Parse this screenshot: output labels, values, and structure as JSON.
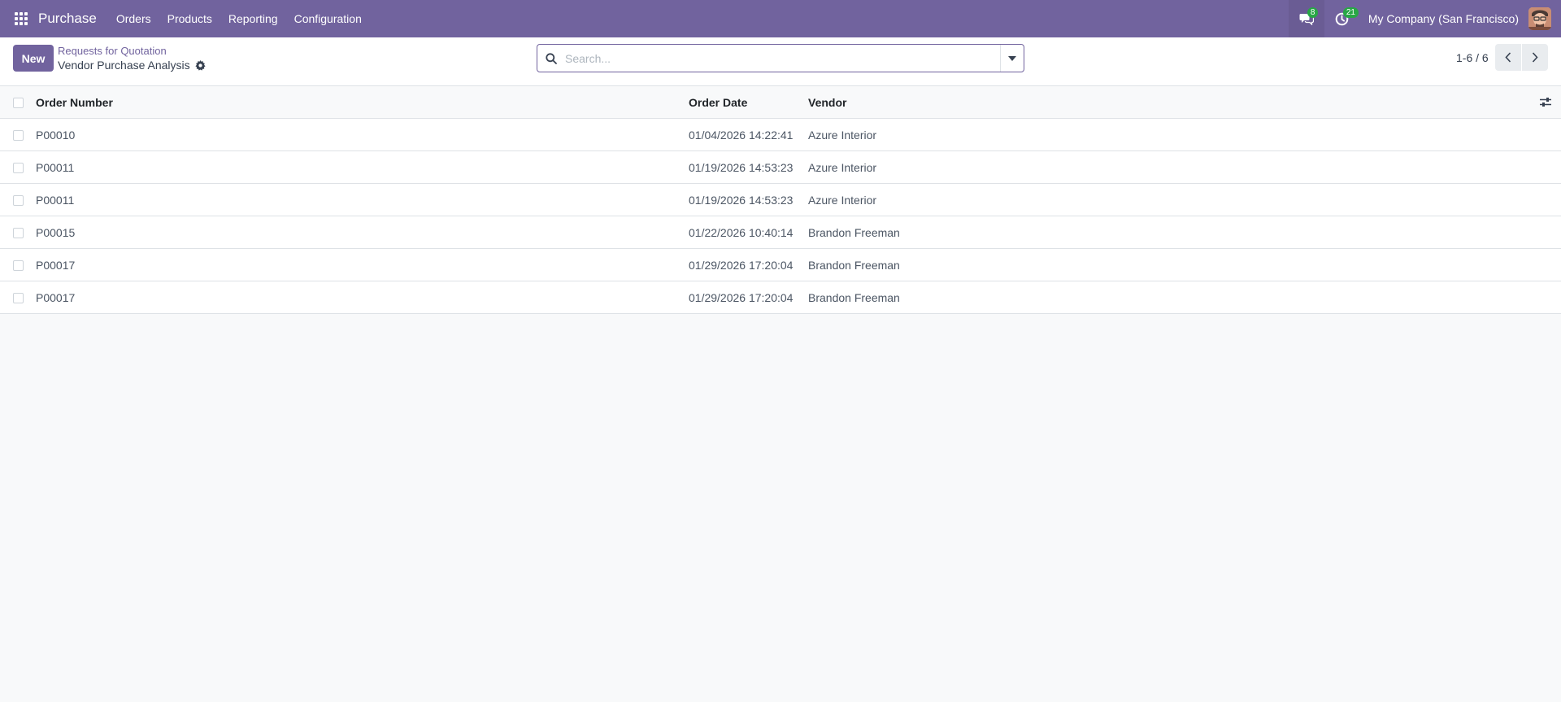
{
  "navbar": {
    "brand": "Purchase",
    "menu": [
      "Orders",
      "Products",
      "Reporting",
      "Configuration"
    ],
    "messages_badge": "8",
    "activities_badge": "21",
    "company": "My Company (San Francisco)"
  },
  "control": {
    "new_label": "New",
    "breadcrumb_parent": "Requests for Quotation",
    "breadcrumb_current": "Vendor Purchase Analysis",
    "search_placeholder": "Search...",
    "pager": "1-6 / 6"
  },
  "table": {
    "headers": [
      "Order Number",
      "Order Date",
      "Vendor"
    ],
    "rows": [
      [
        "P00010",
        "01/04/2026 14:22:41",
        "Azure Interior"
      ],
      [
        "P00011",
        "01/19/2026 14:53:23",
        "Azure Interior"
      ],
      [
        "P00011",
        "01/19/2026 14:53:23",
        "Azure Interior"
      ],
      [
        "P00015",
        "01/22/2026 10:40:14",
        "Brandon Freeman"
      ],
      [
        "P00017",
        "01/29/2026 17:20:04",
        "Brandon Freeman"
      ],
      [
        "P00017",
        "01/29/2026 17:20:04",
        "Brandon Freeman"
      ]
    ]
  },
  "colors": {
    "brand": "#71639e",
    "badge": "#28a745"
  }
}
